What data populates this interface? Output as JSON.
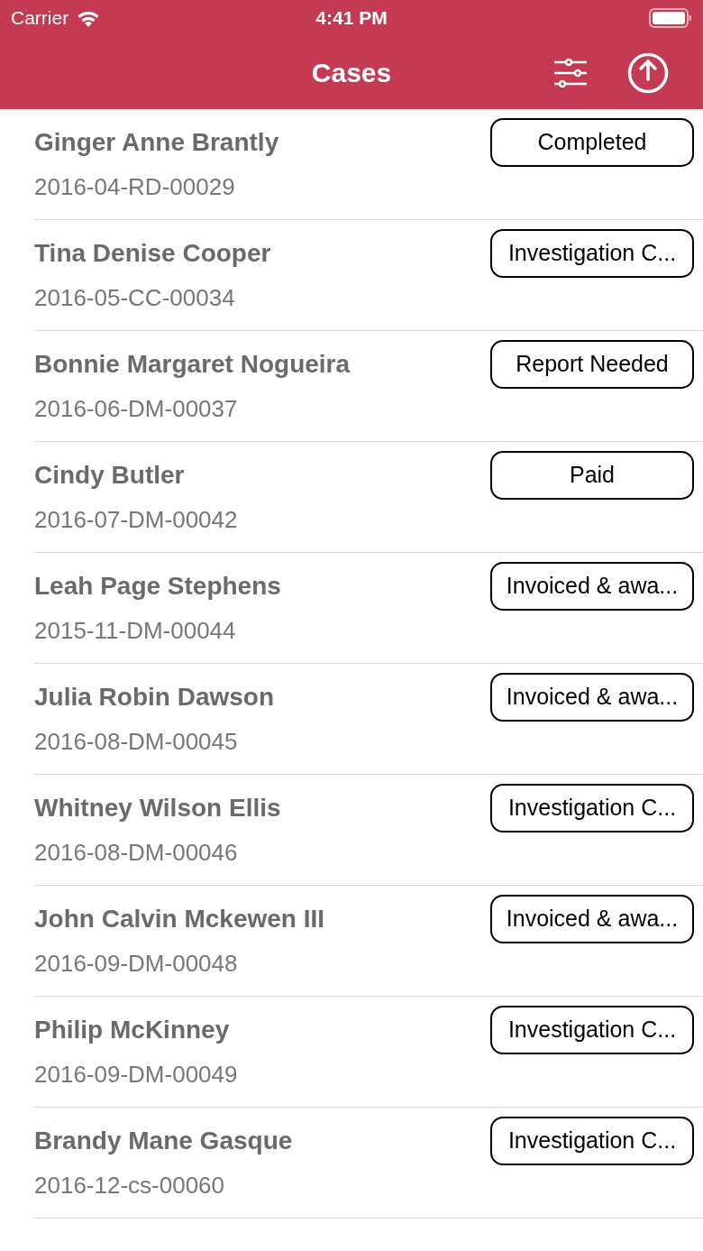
{
  "status_bar": {
    "carrier": "Carrier",
    "time": "4:41 PM"
  },
  "nav": {
    "title": "Cases"
  },
  "cases": [
    {
      "name": "Ginger Anne Brantly",
      "number": "2016-04-RD-00029",
      "status": "Completed"
    },
    {
      "name": "Tina Denise Cooper",
      "number": "2016-05-CC-00034",
      "status": "Investigation C..."
    },
    {
      "name": "Bonnie Margaret Nogueira",
      "number": "2016-06-DM-00037",
      "status": "Report Needed"
    },
    {
      "name": "Cindy Butler",
      "number": "2016-07-DM-00042",
      "status": "Paid"
    },
    {
      "name": "Leah Page Stephens",
      "number": "2015-11-DM-00044",
      "status": "Invoiced & awa..."
    },
    {
      "name": "Julia Robin Dawson",
      "number": "2016-08-DM-00045",
      "status": "Invoiced & awa..."
    },
    {
      "name": "Whitney Wilson Ellis",
      "number": "2016-08-DM-00046",
      "status": "Investigation C..."
    },
    {
      "name": "John Calvin Mckewen III",
      "number": "2016-09-DM-00048",
      "status": "Invoiced & awa..."
    },
    {
      "name": "Philip McKinney",
      "number": "2016-09-DM-00049",
      "status": "Investigation C..."
    },
    {
      "name": "Brandy Mane Gasque",
      "number": "2016-12-cs-00060",
      "status": "Investigation C..."
    }
  ]
}
